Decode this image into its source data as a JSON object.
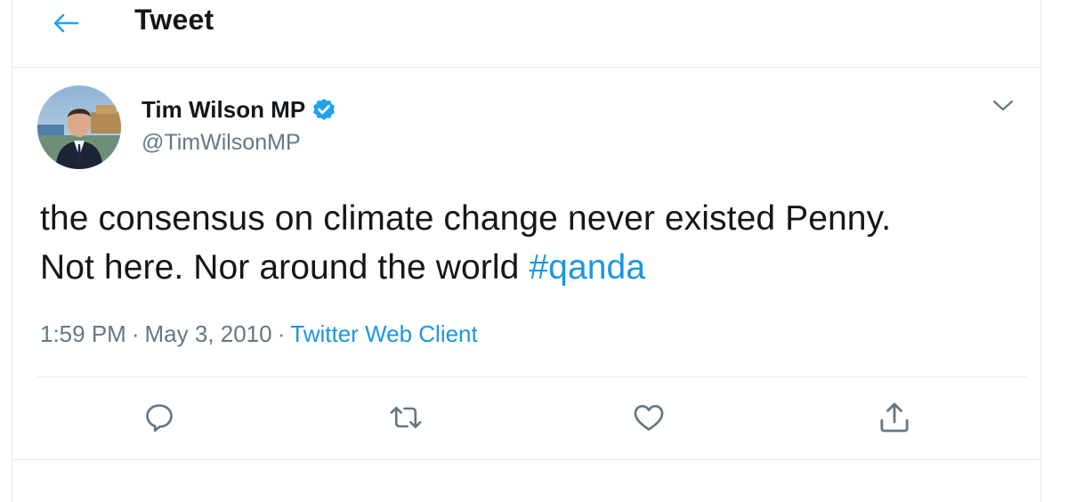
{
  "header": {
    "title": "Tweet",
    "back_icon": "arrow-left-icon"
  },
  "tweet": {
    "author": {
      "display_name": "Tim Wilson MP",
      "handle": "@TimWilsonMP",
      "verified": true,
      "verified_icon": "verified-badge-icon"
    },
    "text_line1": "the consensus on climate change never existed Penny.",
    "text_line2_prefix": "Not here. Nor around the world ",
    "hashtag": "#qanda",
    "time": "1:59 PM",
    "separator": "·",
    "date": "May 3, 2010",
    "source": "Twitter Web Client",
    "menu_icon": "chevron-down-icon"
  },
  "actions": [
    {
      "name": "reply",
      "icon": "reply-icon"
    },
    {
      "name": "retweet",
      "icon": "retweet-icon"
    },
    {
      "name": "like",
      "icon": "heart-icon"
    },
    {
      "name": "share",
      "icon": "share-icon"
    }
  ],
  "colors": {
    "accent": "#1b95e0",
    "secondary_text": "#657786",
    "primary_text": "#14171a",
    "border": "#e6ecf0"
  }
}
